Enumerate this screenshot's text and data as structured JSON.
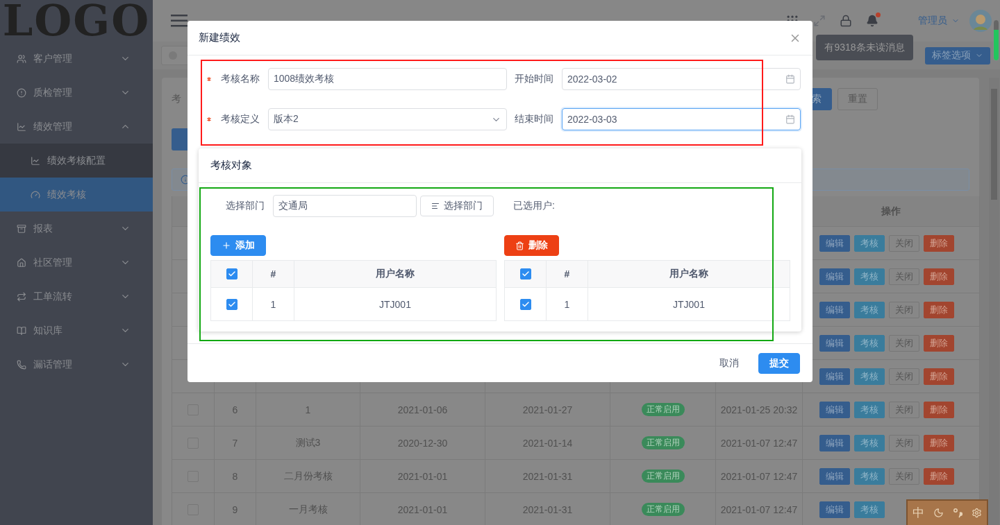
{
  "logo": "LOGO",
  "sidebar": {
    "items": [
      {
        "label": "客户管理",
        "expanded": false
      },
      {
        "label": "质检管理",
        "expanded": false
      },
      {
        "label": "绩效管理",
        "expanded": true,
        "children": [
          {
            "label": "绩效考核配置",
            "selected": false
          },
          {
            "label": "绩效考核",
            "selected": true
          }
        ]
      },
      {
        "label": "报表",
        "expanded": false
      },
      {
        "label": "社区管理",
        "expanded": false
      },
      {
        "label": "工单流转",
        "expanded": false
      },
      {
        "label": "知识库",
        "expanded": false
      },
      {
        "label": "漏话管理",
        "expanded": false
      }
    ]
  },
  "header": {
    "user": "管理员",
    "unread_dot": true,
    "tooltip": "有9318条未读消息"
  },
  "tab_options": "标签选项",
  "search": {
    "label": "考",
    "search_button": "索",
    "reset_button": "重置"
  },
  "table": {
    "columns": {
      "column_8": "操作"
    },
    "rows": [
      {
        "actions": [
          {
            "kind": "edit",
            "label": "编辑"
          },
          {
            "kind": "review",
            "label": "考核"
          },
          {
            "kind": "close",
            "label": "关闭"
          },
          {
            "kind": "delete",
            "label": "删除"
          }
        ]
      },
      {
        "actions": [
          {
            "kind": "edit",
            "label": "编辑"
          },
          {
            "kind": "review",
            "label": "考核"
          },
          {
            "kind": "close",
            "label": "关闭"
          },
          {
            "kind": "delete",
            "label": "删除"
          }
        ]
      },
      {
        "actions": [
          {
            "kind": "edit",
            "label": "编辑"
          },
          {
            "kind": "review",
            "label": "考核"
          },
          {
            "kind": "close",
            "label": "关闭"
          },
          {
            "kind": "delete",
            "label": "删除"
          }
        ]
      },
      {
        "actions": [
          {
            "kind": "edit",
            "label": "编辑"
          },
          {
            "kind": "review",
            "label": "考核"
          },
          {
            "kind": "close",
            "label": "关闭"
          },
          {
            "kind": "delete",
            "label": "删除"
          }
        ]
      },
      {
        "actions": [
          {
            "kind": "edit",
            "label": "编辑"
          },
          {
            "kind": "review",
            "label": "考核"
          },
          {
            "kind": "close",
            "label": "关闭"
          },
          {
            "kind": "delete",
            "label": "删除"
          }
        ]
      },
      {
        "checked": false,
        "index": "6",
        "name": "1",
        "start": "2021-01-06",
        "end": "2021-01-27",
        "status": "正常启用",
        "created": "2021-01-25 20:32",
        "actions": [
          {
            "kind": "edit",
            "label": "编辑"
          },
          {
            "kind": "review",
            "label": "考核"
          },
          {
            "kind": "close",
            "label": "关闭"
          },
          {
            "kind": "delete",
            "label": "删除"
          }
        ]
      },
      {
        "checked": false,
        "index": "7",
        "name": "测试3",
        "start": "2020-12-30",
        "end": "2021-01-14",
        "status": "正常启用",
        "created": "2021-01-07 12:47",
        "actions": [
          {
            "kind": "edit",
            "label": "编辑"
          },
          {
            "kind": "review",
            "label": "考核"
          },
          {
            "kind": "close",
            "label": "关闭"
          },
          {
            "kind": "delete",
            "label": "删除"
          }
        ]
      },
      {
        "checked": false,
        "index": "8",
        "name": "二月份考核",
        "start": "2021-01-01",
        "end": "2021-01-31",
        "status": "正常启用",
        "created": "2021-01-07 12:47",
        "actions": [
          {
            "kind": "edit",
            "label": "编辑"
          },
          {
            "kind": "review",
            "label": "考核"
          },
          {
            "kind": "close",
            "label": "关闭"
          },
          {
            "kind": "delete",
            "label": "删除"
          }
        ]
      },
      {
        "checked": false,
        "index": "9",
        "name": "一月考核",
        "start": "2021-01-01",
        "end": "2021-01-31",
        "status": "正常启用",
        "created": "2021-01-07 12:47",
        "actions": [
          {
            "kind": "edit",
            "label": "编辑"
          },
          {
            "kind": "review",
            "label": "考核"
          }
        ]
      }
    ]
  },
  "modal": {
    "title": "新建绩效",
    "fields": [
      {
        "label": "考核名称",
        "required": true,
        "kind": "text",
        "value": "1008绩效考核",
        "focused": false
      },
      {
        "label": "开始时间",
        "required": false,
        "kind": "date",
        "value": "2022-03-02",
        "focused": false
      },
      {
        "label": "考核定义",
        "required": true,
        "kind": "select",
        "value": "版本2",
        "focused": false
      },
      {
        "label": "结束时间",
        "required": false,
        "kind": "date",
        "value": "2022-03-03",
        "focused": true
      }
    ],
    "target": {
      "title": "考核对象",
      "dept_label": "选择部门",
      "dept_value": "交通局",
      "dept_button": "选择部门",
      "selected_label": "已选用户:",
      "add_button": "添加",
      "delete_button": "删除",
      "left_table": {
        "all_checked": true,
        "columns": [
          "#",
          "用户名称"
        ],
        "rows": [
          {
            "checked": true,
            "index": "1",
            "name": "JTJ001"
          }
        ]
      },
      "right_table": {
        "all_checked": true,
        "columns": [
          "#",
          "用户名称"
        ],
        "rows": [
          {
            "checked": true,
            "index": "1",
            "name": "JTJ001"
          }
        ]
      }
    },
    "cancel": "取消",
    "submit": "提交"
  },
  "annotations": [
    {
      "color": "#ff1a1a"
    },
    {
      "color": "#12a812"
    }
  ],
  "corner_ribbon": {
    "label": "中"
  }
}
